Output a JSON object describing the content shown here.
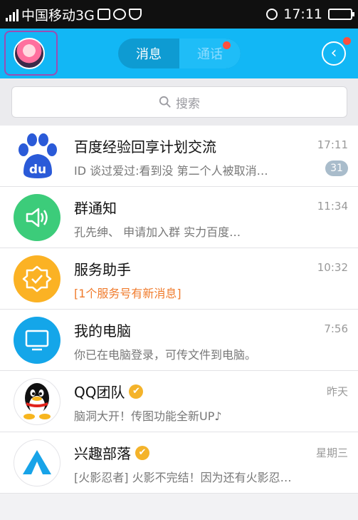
{
  "status_bar": {
    "network_label": "中国移动3G",
    "time": "17:11",
    "signal_icon": "signal-icon",
    "alarm_icon": "alarm-icon"
  },
  "header": {
    "tabs": [
      {
        "label": "消息",
        "selected": true
      },
      {
        "label": "通话",
        "selected": false
      }
    ],
    "avatar_icon": "profile-avatar",
    "back_icon": "back-arrow-icon",
    "accent_color": "#12b7f5"
  },
  "search": {
    "placeholder": "搜索",
    "icon": "search-icon"
  },
  "conversations": [
    {
      "name": "百度经验回享计划交流",
      "preview": "ID 谈过爱过:看到没 第二个人被取消…",
      "time": "17:11",
      "badge": "31",
      "icon": "baidu-paw-icon",
      "color": "#2a5ad8"
    },
    {
      "name": "群通知",
      "preview": "孔先绅、 申请加入群 实力百度…",
      "time": "11:34",
      "icon": "speaker-icon",
      "color": "#3ccc7a"
    },
    {
      "name": "服务助手",
      "preview": "[1个服务号有新消息]",
      "time": "10:32",
      "icon": "service-badge-icon",
      "color": "#fbb224"
    },
    {
      "name": "我的电脑",
      "preview": "你已在电脑登录，可传文件到电脑。",
      "time": "7:56",
      "icon": "monitor-icon",
      "color": "#14a6e9"
    },
    {
      "name": "QQ团队",
      "preview": "脑洞大开！传图功能全新UP♪",
      "time": "昨天",
      "icon": "qq-penguin-icon",
      "verified": true
    },
    {
      "name": "兴趣部落",
      "preview": "[火影忍者] 火影不完结！因为还有火影忍…",
      "time": "星期三",
      "icon": "tent-icon",
      "verified": true,
      "color": "#17a3e8"
    }
  ]
}
